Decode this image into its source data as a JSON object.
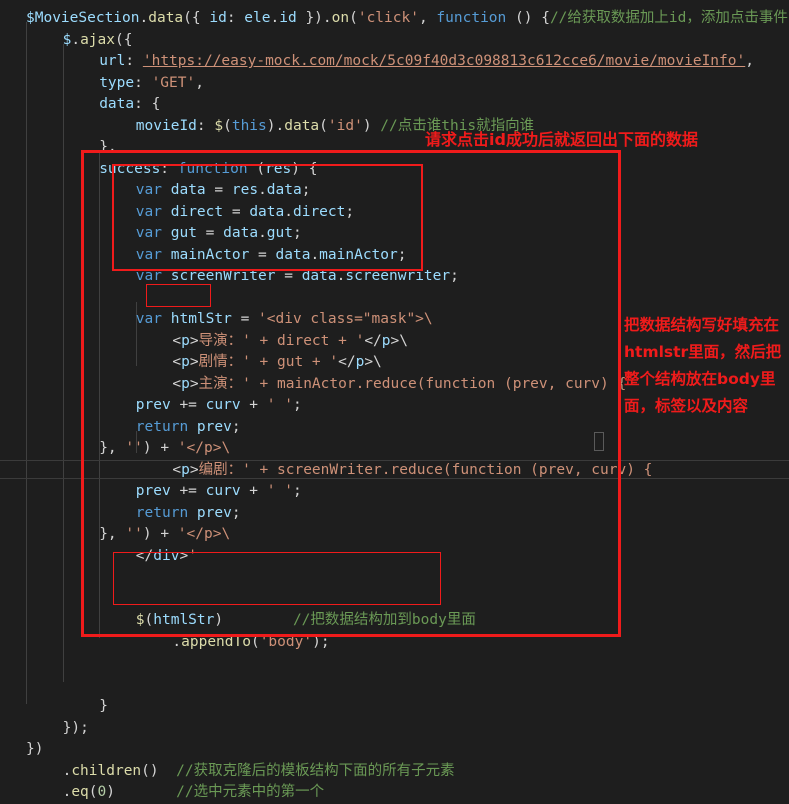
{
  "editor": {
    "theme_background": "#1e1e1e",
    "default_text_color": "#d4d4d4",
    "annotation_color": "#f01b1b"
  },
  "code_lines": [
    {
      "indent": 0,
      "text": "$MovieSection.data({ id: ele.id }).on('click', function () {//给获取数据加上id，添加点击事件"
    },
    {
      "indent": 1,
      "text": "$.ajax({"
    },
    {
      "indent": 2,
      "text": "url: 'https://easy-mock.com/mock/5c09f40d3c098813c612cce6/movie/movieInfo',"
    },
    {
      "indent": 2,
      "text": "type: 'GET',"
    },
    {
      "indent": 2,
      "text": "data: {"
    },
    {
      "indent": 3,
      "text": "movieId: $(this).data('id') //点击谁this就指向谁"
    },
    {
      "indent": 2,
      "text": "},"
    },
    {
      "indent": 2,
      "text": "success: function (res) {"
    },
    {
      "indent": 3,
      "text": "var data = res.data;"
    },
    {
      "indent": 3,
      "text": "var direct = data.direct;"
    },
    {
      "indent": 3,
      "text": "var gut = data.gut;"
    },
    {
      "indent": 3,
      "text": "var mainActor = data.mainActor;"
    },
    {
      "indent": 3,
      "text": "var screenWriter = data.screenwriter;"
    },
    {
      "indent": 0,
      "text": ""
    },
    {
      "indent": 3,
      "text": "var htmlStr = '<div class=\"mask\">\\"
    },
    {
      "indent": 4,
      "text": "<p>导演：' + direct + '</p>\\"
    },
    {
      "indent": 4,
      "text": "<p>剧情：' + gut + '</p>\\"
    },
    {
      "indent": 4,
      "text": "<p>主演：' + mainActor.reduce(function (prev, curv) {"
    },
    {
      "indent": 3,
      "text": "prev += curv + ' ';"
    },
    {
      "indent": 3,
      "text": "return prev;"
    },
    {
      "indent": 2,
      "text": "}, '') + '</p>\\"
    },
    {
      "indent": 4,
      "text": "<p>编剧：' + screenWriter.reduce(function (prev, curv) {"
    },
    {
      "indent": 3,
      "text": "prev += curv + ' ';"
    },
    {
      "indent": 3,
      "text": "return prev;"
    },
    {
      "indent": 2,
      "text": "}, '') + '</p>\\"
    },
    {
      "indent": 3,
      "text": "</div>'"
    },
    {
      "indent": 0,
      "text": ""
    },
    {
      "indent": 0,
      "text": ""
    },
    {
      "indent": 3,
      "text": "$(htmlStr)        //把数据结构加到body里面"
    },
    {
      "indent": 4,
      "text": ".appendTo('body');"
    },
    {
      "indent": 0,
      "text": ""
    },
    {
      "indent": 0,
      "text": ""
    },
    {
      "indent": 2,
      "text": "}"
    },
    {
      "indent": 1,
      "text": "});"
    },
    {
      "indent": 0,
      "text": "})"
    },
    {
      "indent": 1,
      "text": ".children()  //获取克隆后的模板结构下面的所有子元素"
    },
    {
      "indent": 1,
      "text": ".eq(0)       //选中元素中的第一个"
    }
  ],
  "annotations": {
    "top_note": "请求点击id成功后就返回出下面的数据",
    "side_note": "把数据结构写好填充在htmlstr里面，然后把整个结构放在body里面，标签以及内容",
    "boxes": [
      {
        "name": "outer-success-block-box"
      },
      {
        "name": "var-declarations-box"
      },
      {
        "name": "htmlstr-variable-box"
      },
      {
        "name": "append-to-body-box"
      }
    ]
  }
}
